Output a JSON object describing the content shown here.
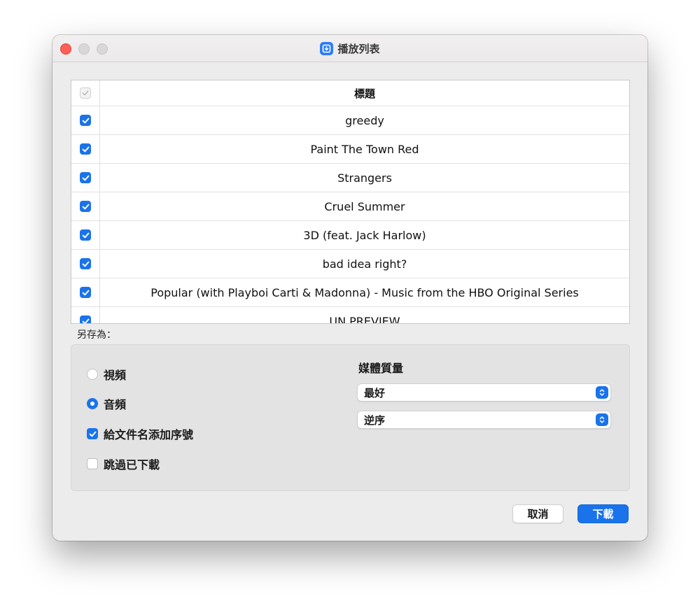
{
  "window": {
    "title": "播放列表"
  },
  "table": {
    "header": "標題",
    "rows": [
      "greedy",
      "Paint The Town Red",
      "Strangers",
      "Cruel Summer",
      "3D (feat. Jack Harlow)",
      "bad idea right?",
      "Popular (with Playboi Carti & Madonna) - Music from the HBO Original Series",
      "UN PREVIEW"
    ]
  },
  "save_as": {
    "label": "另存為：",
    "video_label": "視頻",
    "audio_label": "音頻",
    "selected_format": "音頻",
    "add_sequence_label": "給文件名添加序號",
    "add_sequence_checked": true,
    "skip_downloaded_label": "跳過已下載",
    "skip_downloaded_checked": false,
    "quality_label": "媒體質量",
    "quality_value": "最好",
    "order_value": "逆序"
  },
  "buttons": {
    "cancel": "取消",
    "download": "下載"
  },
  "colors": {
    "accent": "#1a73ea",
    "close": "#fe5f57"
  }
}
